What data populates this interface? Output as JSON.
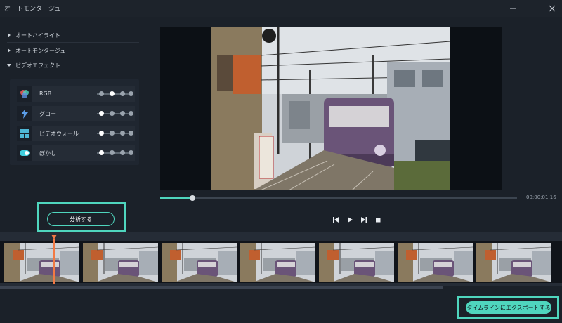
{
  "window": {
    "title": "オートモンタージュ",
    "controls": [
      "minimize-icon",
      "maximize-icon",
      "close-icon"
    ]
  },
  "sidebar": {
    "sections": [
      {
        "label": "オートハイライト",
        "expanded": false
      },
      {
        "label": "オートモンタージュ",
        "expanded": false
      },
      {
        "label": "ビデオエフェクト",
        "expanded": true
      }
    ],
    "effects": [
      {
        "label": "RGB",
        "icon": "rgb-icon",
        "slider_level": 0.5
      },
      {
        "label": "グロー",
        "icon": "glow-icon",
        "slider_level": 0.0
      },
      {
        "label": "ビデオウォール",
        "icon": "video-wall-icon",
        "slider_level": 0.0
      },
      {
        "label": "ぼかし",
        "icon": "blur-icon",
        "slider_level": 0.0
      }
    ],
    "analyze_label": "分析する"
  },
  "preview": {
    "timecode": "00:00:01:16",
    "progress": 0.09,
    "controls": [
      "prev-frame-icon",
      "play-icon",
      "next-frame-icon",
      "stop-icon"
    ]
  },
  "timeline": {
    "thumbnail_count": 7,
    "playhead_marker": "playhead-icon"
  },
  "footer": {
    "export_label": "タイムラインにエクスポートする"
  },
  "colors": {
    "accent": "#4fd6be",
    "playhead": "#f27a45",
    "background": "#1b2129"
  }
}
